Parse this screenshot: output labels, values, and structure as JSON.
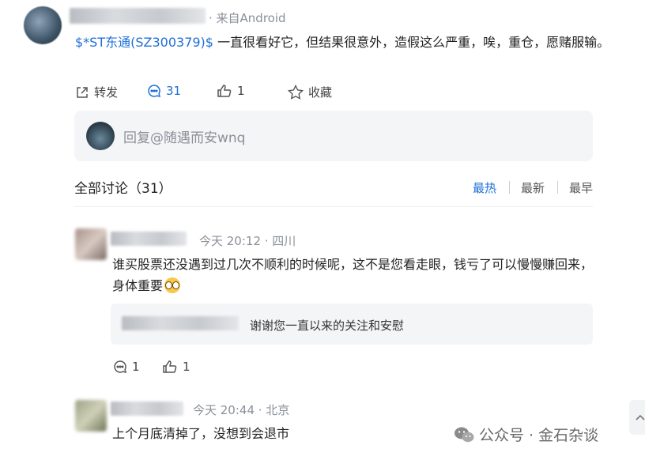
{
  "post": {
    "source": "· 来自Android",
    "stock_tag": "$*ST东通(SZ300379)$",
    "text": " 一直很看好它，但结果很意外，造假这么严重，唉，重仓，愿赌服输。",
    "actions": {
      "repost_label": "转发",
      "comment_count": "31",
      "like_count": "1",
      "favorite_label": "收藏"
    }
  },
  "reply_input": {
    "placeholder": "回复@随遇而安wnq"
  },
  "discussion": {
    "title": "全部讨论（31）",
    "sort": {
      "hot": "最热",
      "new": "最新",
      "old": "最早"
    }
  },
  "comments": [
    {
      "meta": "今天 20:12 · 四川",
      "text": "谁买股票还没遇到过几次不顺利的时候呢，这不是您看走眼，钱亏了可以慢慢赚回来，身体重要",
      "reply_text": "谢谢您一直以来的关注和安慰",
      "comment_count": "1",
      "like_count": "1"
    },
    {
      "meta": "今天 20:44 · 北京",
      "text": "上个月底清掉了，没想到会退市"
    }
  ],
  "watermark": "公众号 · 金石杂谈",
  "colors": {
    "accent": "#1f6fd6",
    "muted": "#8a9099",
    "panel": "#f4f5f7"
  }
}
